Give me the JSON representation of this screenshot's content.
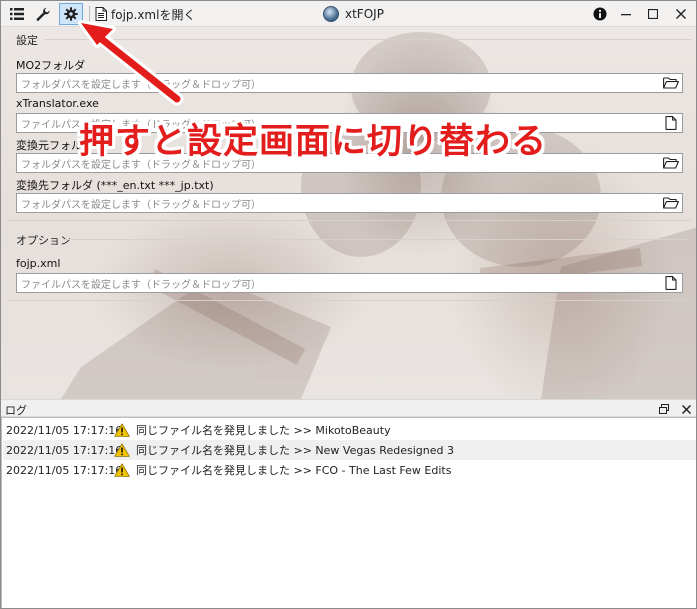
{
  "toolbar": {
    "open_file_label": "fojp.xmlを開く"
  },
  "app": {
    "title": "xtFOJP"
  },
  "settings": {
    "group_label": "設定",
    "fields": [
      {
        "label": "MO2フォルダ",
        "placeholder": "フォルダパスを設定します（ドラッグ＆ドロップ可）",
        "button_icon": "folder-open-icon"
      },
      {
        "label": "xTranslator.exe",
        "placeholder": "ファイルパスを設定します（ドラッグ＆ドロップ可）",
        "button_icon": "file-icon"
      },
      {
        "label": "変換元フォルダ",
        "placeholder": "フォルダパスを設定します（ドラッグ＆ドロップ可）",
        "button_icon": "folder-open-icon"
      },
      {
        "label": "変換先フォルダ (***_en.txt ***_jp.txt)",
        "placeholder": "フォルダパスを設定します（ドラッグ＆ドロップ可）",
        "button_icon": "folder-open-icon"
      }
    ]
  },
  "options": {
    "group_label": "オプション",
    "fields": [
      {
        "label": "fojp.xml",
        "placeholder": "ファイルパスを設定します（ドラッグ＆ドロップ可）",
        "button_icon": "file-icon"
      }
    ]
  },
  "annotation": {
    "text": "押すと設定画面に切り替わる",
    "color": "#e31c1c"
  },
  "log": {
    "title": "ログ",
    "entries": [
      {
        "timestamp": "2022/11/05 17:17:16",
        "level": "warning",
        "message": "同じファイル名を発見しました >> MikotoBeauty"
      },
      {
        "timestamp": "2022/11/05 17:17:16",
        "level": "warning",
        "message": "同じファイル名を発見しました >> New Vegas Redesigned 3"
      },
      {
        "timestamp": "2022/11/05 17:17:16",
        "level": "warning",
        "message": "同じファイル名を発見しました >> FCO - The Last Few Edits"
      }
    ]
  },
  "colors": {
    "active_tab_bg": "#cfe5fa",
    "active_tab_border": "#6fa9de",
    "warning": "#f5c400"
  }
}
